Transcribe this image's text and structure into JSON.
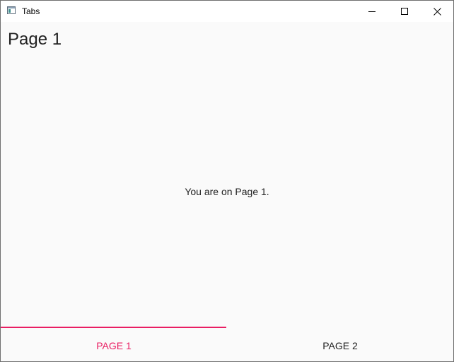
{
  "window": {
    "title": "Tabs",
    "app_icon": "window-app-icon",
    "controls": {
      "minimize_icon": "minimize-icon",
      "maximize_icon": "maximize-icon",
      "close_icon": "close-icon"
    }
  },
  "page": {
    "title": "Page 1",
    "message": "You are on Page 1."
  },
  "tabs": [
    {
      "label": "PAGE 1",
      "selected": true
    },
    {
      "label": "PAGE 2",
      "selected": false
    }
  ],
  "colors": {
    "accent": "#e91e63",
    "text": "#212121",
    "background": "#fafafa"
  }
}
